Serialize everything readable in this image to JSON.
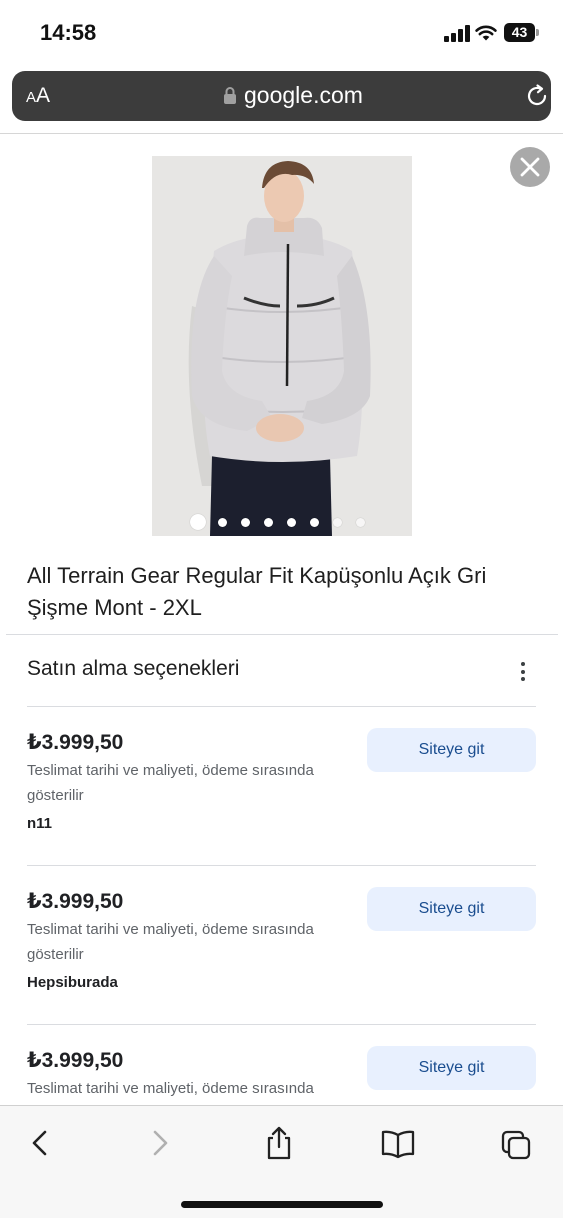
{
  "status_bar": {
    "time": "14:58",
    "battery": "43",
    "battery_level_percent": 43
  },
  "browser": {
    "text_size_small": "A",
    "text_size_large": "A",
    "url": "google.com",
    "icons": [
      "lock-icon",
      "reload-icon"
    ]
  },
  "product": {
    "title": "All Terrain Gear Regular Fit Kapüşonlu Açık Gri Şişme Mont - 2XL",
    "image_count": 8,
    "active_image_index": 0
  },
  "purchase": {
    "section_title": "Satın alma seçenekleri",
    "offers": [
      {
        "price": "₺3.999,50",
        "delivery": "Teslimat tarihi ve maliyeti, ödeme sırasında gösterilir",
        "seller": "n11",
        "button": "Siteye git"
      },
      {
        "price": "₺3.999,50",
        "delivery": "Teslimat tarihi ve maliyeti, ödeme sırasında gösterilir",
        "seller": "Hepsiburada",
        "button": "Siteye git"
      },
      {
        "price": "₺3.999,50",
        "delivery": "Teslimat tarihi ve maliyeti, ödeme sırasında",
        "seller": "",
        "button": "Siteye git"
      }
    ]
  },
  "toolbar": {
    "icons": [
      "back-icon",
      "forward-icon",
      "share-icon",
      "bookmarks-icon",
      "tabs-icon"
    ]
  },
  "colors": {
    "url_bar": "#3c3c3c",
    "button_bg": "#e8f0fe",
    "button_text": "#1a4d8f"
  }
}
